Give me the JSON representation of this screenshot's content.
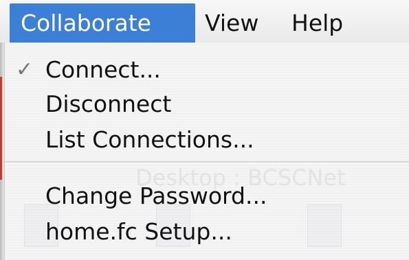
{
  "menubar": {
    "items": [
      {
        "label": "Collaborate",
        "active": true
      },
      {
        "label": "View",
        "active": false
      },
      {
        "label": "Help",
        "active": false
      }
    ]
  },
  "menu": {
    "items": [
      {
        "label": "Connect...",
        "checked": true,
        "check_glyph": "✓"
      },
      {
        "label": "Disconnect",
        "checked": false
      },
      {
        "label": "List Connections...",
        "checked": false
      },
      {
        "label": "Change Password...",
        "checked": false
      },
      {
        "label": "home.fc Setup...",
        "checked": false
      }
    ]
  },
  "background_window": {
    "title": "Desktop : BCSCNet"
  },
  "colors": {
    "highlight": "#3b80d6",
    "menu_background": "#f4f4f4",
    "text": "#111111"
  }
}
